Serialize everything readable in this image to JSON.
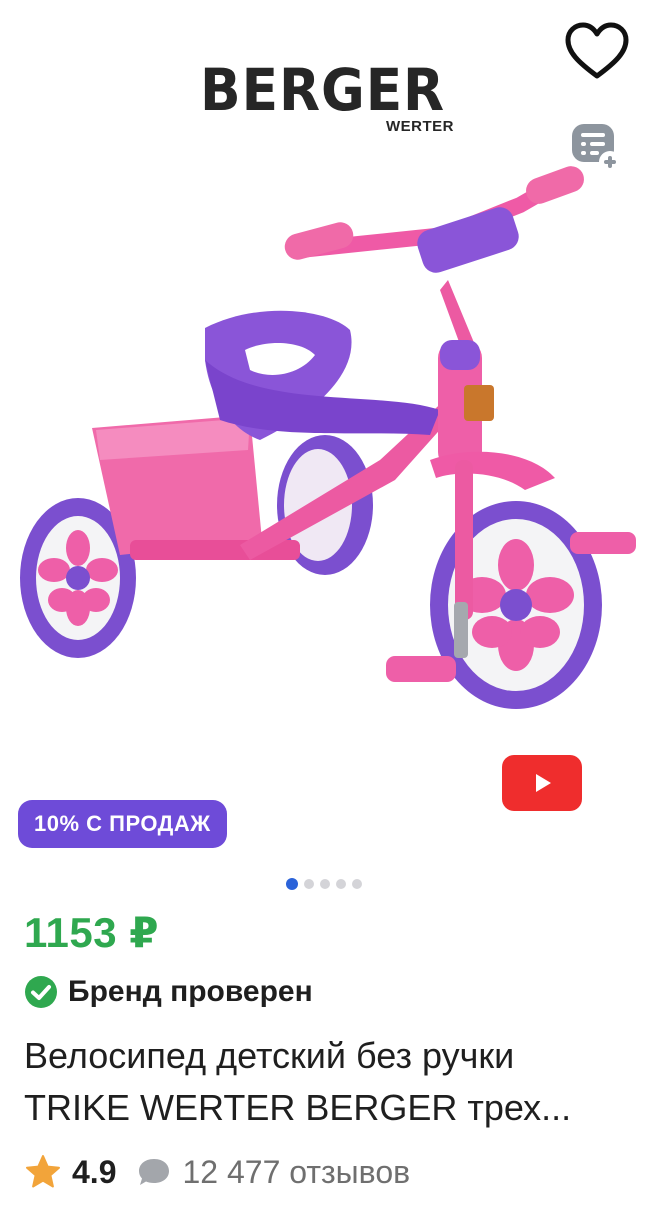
{
  "brand": {
    "name": "BERGER",
    "subname": "WERTER"
  },
  "promo": {
    "label": "10% С ПРОДАЖ"
  },
  "gallery": {
    "total_slides": 5,
    "active_slide": 1
  },
  "price": {
    "value": "1153 ₽",
    "color": "#2fa84f"
  },
  "verification": {
    "label": "Бренд проверен",
    "color": "#2fa84f"
  },
  "product": {
    "title_line1": "Велосипед детский без ручки",
    "title_line2": "TRIKE WERTER BERGER трех..."
  },
  "rating": {
    "value": "4.9",
    "reviews_count": "12 477",
    "reviews_label": "отзывов"
  },
  "icons": {
    "favorite": "heart-icon",
    "compare": "compare-add-icon",
    "video": "play-icon",
    "verified": "check-circle-icon",
    "star": "star-icon",
    "reviews": "chat-bubble-icon"
  },
  "colors": {
    "accent_purple": "#6e4bd8",
    "video_red": "#ef2d2d",
    "dot_active": "#2b63d9"
  }
}
